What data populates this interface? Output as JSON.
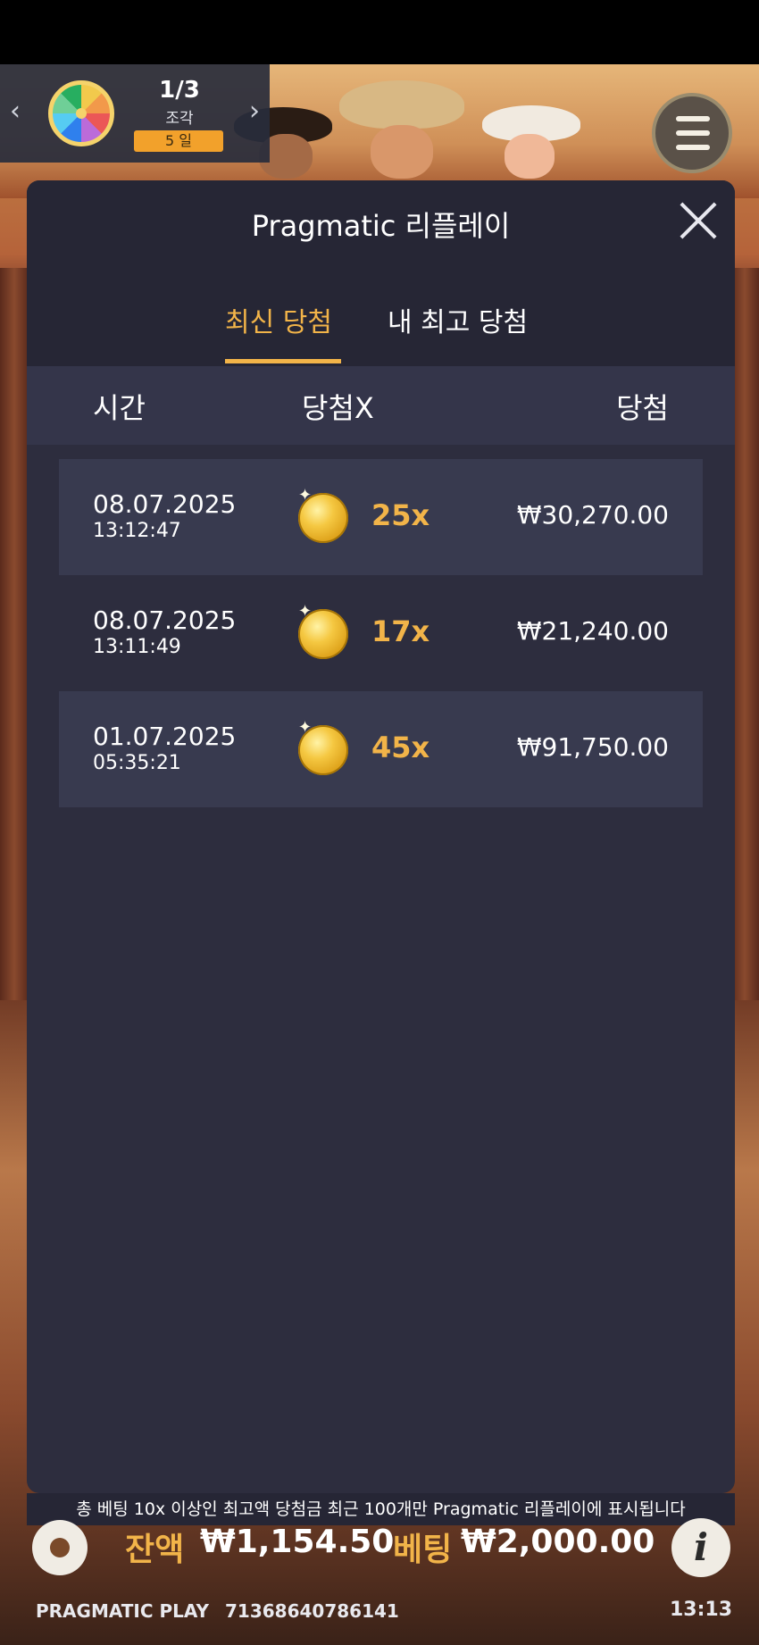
{
  "fragments": {
    "count": "1/3",
    "label": "조각",
    "days": "5 일"
  },
  "modal": {
    "title": "Pragmatic 리플레이",
    "tabs": [
      {
        "label": "최신 당첨",
        "active": true
      },
      {
        "label": "내 최고 당첨",
        "active": false
      }
    ],
    "columns": {
      "time": "시간",
      "multiplier": "당첨X",
      "win": "당첨"
    },
    "rows": [
      {
        "date": "08.07.2025",
        "time": "13:12:47",
        "multiplier": "25x",
        "amount": "₩30,270.00"
      },
      {
        "date": "08.07.2025",
        "time": "13:11:49",
        "multiplier": "17x",
        "amount": "₩21,240.00"
      },
      {
        "date": "01.07.2025",
        "time": "05:35:21",
        "multiplier": "45x",
        "amount": "₩91,750.00"
      }
    ],
    "footer_note": "총 베팅 10x 이상인 최고액 당첨금 최근 100개만 Pragmatic 리플레이에 표시됩니다"
  },
  "bottom": {
    "balance_label": "잔액",
    "balance_value": "₩1,154.50",
    "bet_label": "베팅",
    "bet_value": "₩2,000.00",
    "brand": "PRAGMATIC PLAY",
    "session_id": "71368640786141",
    "clock": "13:13"
  },
  "colors": {
    "accent": "#f2b449",
    "modal_bg": "#2d2d3e",
    "row_bg": "#383a4f"
  },
  "icons": [
    "chevron-left-icon",
    "chevron-right-icon",
    "wheel-icon",
    "menu-icon",
    "close-icon",
    "coin-icon",
    "gear-icon",
    "info-icon"
  ]
}
